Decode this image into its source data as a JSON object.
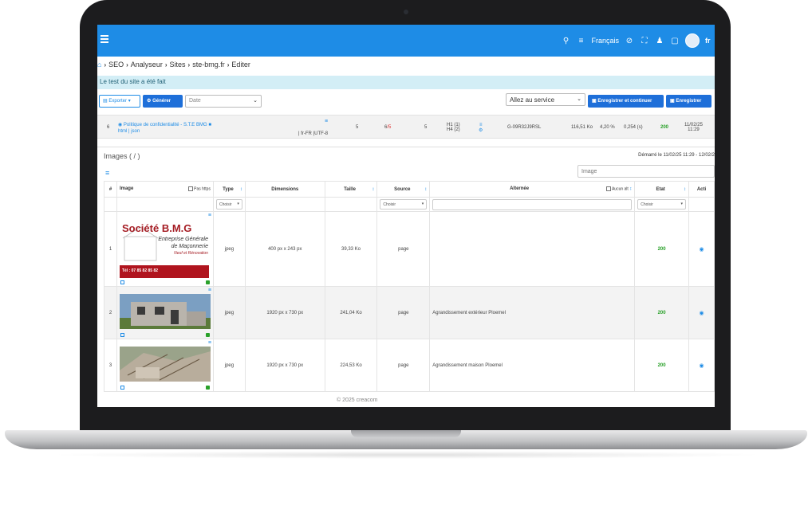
{
  "topbar": {
    "language": "Français",
    "user_initial": "fr"
  },
  "breadcrumb": [
    "SEO",
    "Analyseur",
    "Sites",
    "ste-bmg.fr",
    "Editer"
  ],
  "alert": "Le test du site a été fait",
  "toolbar": {
    "export_label": "Exporter",
    "generate_label": "Générer",
    "date_placeholder": "Date",
    "service_label": "Allez au service",
    "save_continue_label": "Enregistrer et continuer",
    "save_label": "Enregistrer"
  },
  "page_row": {
    "index": "6",
    "title": "Politique de confidentialité - S.T.E BMG",
    "links": "html | json",
    "lang": "| fr-FR |UTF-8",
    "c1": "5",
    "c2a": "6",
    "c2b": "/5",
    "c3": "5",
    "h1": "H1 (1)",
    "h4": "H4 (2)",
    "ga": "G-09R32J9RSL",
    "size": "116,51 Ko",
    "pct": "4,20 %",
    "time": "0,254 (s)",
    "status": "200",
    "date": "11/02/25",
    "time2": "11:29"
  },
  "panel": {
    "title": "Images ( / )",
    "started": "Démarré le 11/02/25 11:29 - 12/02/2",
    "search_placeholder": "Image"
  },
  "table": {
    "headers": {
      "num": "#",
      "image": "Image",
      "not_https": "Pas https",
      "type": "Type",
      "dimensions": "Dimensions",
      "size": "Taille",
      "source": "Source",
      "alt": "Alternée",
      "no_alt": "Aucun alt",
      "state": "Etat",
      "actions": "Acti"
    },
    "filters": {
      "type": "Choisir",
      "source": "Choisir",
      "state": "Choisir"
    },
    "rows": [
      {
        "num": "1",
        "type": "jpeg",
        "dimensions": "400 px x 243 px",
        "size": "39,33 Ko",
        "source": "page",
        "alt": "",
        "state": "200"
      },
      {
        "num": "2",
        "type": "jpeg",
        "dimensions": "1920 px x 730 px",
        "size": "241,04 Ko",
        "source": "page",
        "alt": "Agrandissement extérieur Ploemel",
        "state": "200"
      },
      {
        "num": "3",
        "type": "jpeg",
        "dimensions": "1920 px x 730 px",
        "size": "224,53 Ko",
        "source": "page",
        "alt": "Agrandissement maison Ploemel",
        "state": "200"
      }
    ]
  },
  "logo_image": {
    "line1": "Société B.M.G",
    "line2": "Entreprise Générale",
    "line3": "de Maçonnerie",
    "line4": "Neuf et Rénovation",
    "phone": "Tél : 07 85 82 85 82"
  },
  "footer": "© 2025 creacom",
  "colors": {
    "topbar": "#1e8ce6",
    "status_ok": "#2aa12a",
    "alert_bg": "#d3eef6"
  }
}
